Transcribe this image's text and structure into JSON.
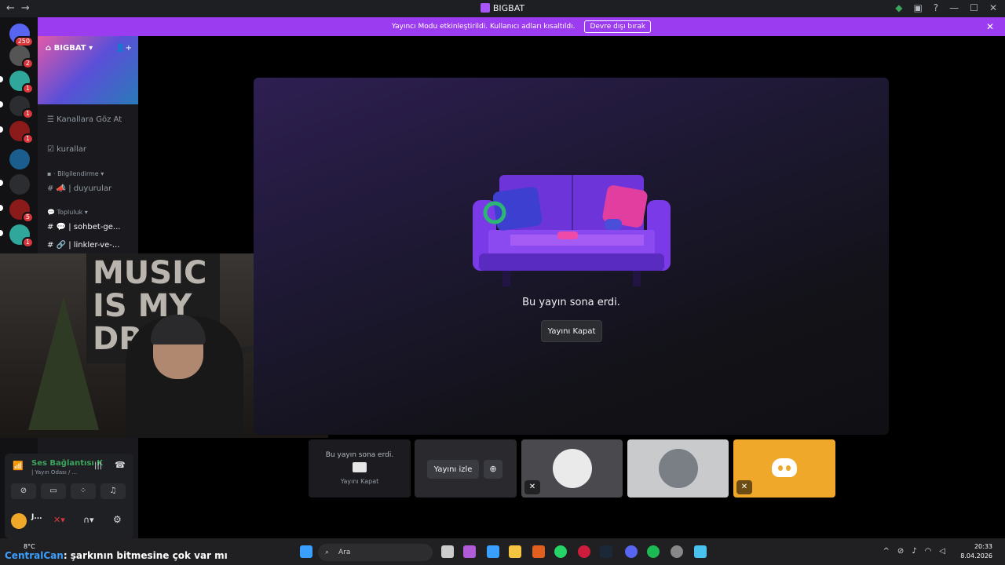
{
  "window": {
    "title": "BIGBAT",
    "back_icon": "←",
    "forward_icon": "→"
  },
  "banner": {
    "text": "Yayıncı Modu etkinleştirildi. Kullanıcı adları kısaltıldı.",
    "button": "Devre dışı bırak"
  },
  "guilds": {
    "badges": [
      "250",
      "2",
      "1",
      "1",
      "1",
      "5",
      "1"
    ]
  },
  "server": {
    "name": "BIGBAT",
    "browse_channels": "Kanallara Göz At",
    "rules_channel": "kurallar",
    "category_info": "Bilgilendirme",
    "announcements_channel": "| duyurular",
    "category_community": "Topluluk",
    "chat_channel": "| sohbet-ge...",
    "links_channel": "| linkler-ve-..."
  },
  "webcam": {
    "poster_text": "MUSIC\nIS MY\nDRUG"
  },
  "stage": {
    "ended_message": "Bu yayın sona erdi.",
    "close_button": "Yayını Kapat"
  },
  "tiles": {
    "ended_message": "Bu yayın sona erdi.",
    "close_label": "Yayını Kapat",
    "watch_button": "Yayını izle"
  },
  "voice": {
    "status": "Ses Bağlantısı K",
    "channel": "| Yayın Odası / ...",
    "username": "J..."
  },
  "taskbar": {
    "temperature": "8°C",
    "overlay_name": "CentralCan",
    "overlay_message": ": şarkının bitmesine çok var mı",
    "search_placeholder": "Ara",
    "time": "20:33",
    "date": "8.04.2026"
  },
  "colors": {
    "banner": "#9b3cf0",
    "accent_green": "#3ba55c",
    "discord_tile": "#f0a82a"
  }
}
